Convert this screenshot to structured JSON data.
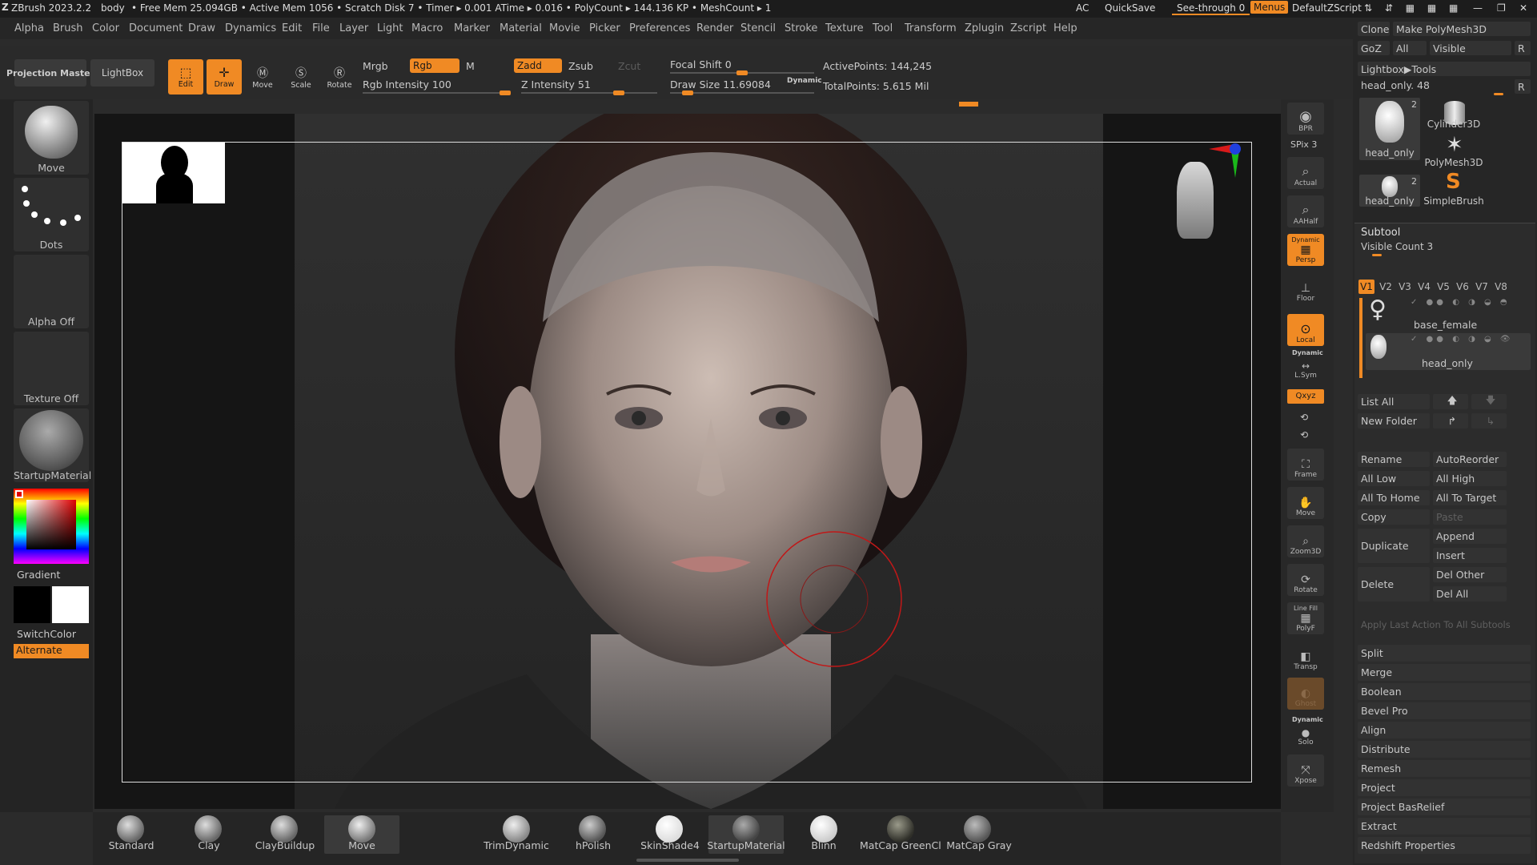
{
  "titlebar": {
    "app": "ZBrush 2023.2.2",
    "doc": "body",
    "status": "• Free Mem 25.094GB • Active Mem 1056 • Scratch Disk 7 • Timer ▸ 0.001 ATime ▸ 0.016 • PolyCount ▸ 144.136 KP • MeshCount ▸ 1",
    "ac": "AC",
    "quicksave": "QuickSave",
    "see_through": "See-through  0",
    "menus": "Menus",
    "zscript": "DefaultZScript"
  },
  "menu": [
    "Alpha",
    "Brush",
    "Color",
    "Document",
    "Draw",
    "Dynamics",
    "Edit",
    "File",
    "Layer",
    "Light",
    "Macro",
    "Marker",
    "Material",
    "Movie",
    "Picker",
    "Preferences",
    "Render",
    "Stencil",
    "Stroke",
    "Texture",
    "Tool",
    "Transform",
    "Zplugin",
    "Zscript",
    "Help"
  ],
  "toolbar": {
    "projection_master": "Projection Master",
    "lightbox": "LightBox",
    "edit": "Edit",
    "draw": "Draw",
    "move": "Move",
    "scale": "Scale",
    "rotate": "Rotate",
    "mrgb": "Mrgb",
    "rgb": "Rgb",
    "m": "M",
    "rgb_intensity": "Rgb Intensity 100",
    "zadd": "Zadd",
    "zsub": "Zsub",
    "zcut": "Zcut",
    "z_intensity": "Z Intensity 51",
    "focal_shift": "Focal Shift 0",
    "draw_size": "Draw Size 11.69084",
    "dynamic": "Dynamic",
    "active_points": "ActivePoints: 144,245",
    "total_points": "TotalPoints: 5.615 Mil"
  },
  "left": {
    "brush": "Move",
    "stroke": "Dots",
    "alpha": "Alpha Off",
    "texture": "Texture Off",
    "material": "StartupMaterial",
    "gradient": "Gradient",
    "switchcolor": "SwitchColor",
    "alternate": "Alternate"
  },
  "right_shelf": {
    "bpr": "BPR",
    "spix": "SPix 3",
    "actual": "Actual",
    "aahalf": "AAHalf",
    "dynamic1": "Dynamic",
    "persp": "Persp",
    "floor": "Floor",
    "local": "Local",
    "dynamic2": "Dynamic",
    "lsym": "L.Sym",
    "xyz": "Qxyz",
    "frame": "Frame",
    "move": "Move",
    "zoom3d": "Zoom3D",
    "rotate": "Rotate",
    "linefill": "Line Fill",
    "polyf": "PolyF",
    "transp": "Transp",
    "ghost": "Ghost",
    "dynamic3": "Dynamic",
    "solo": "Solo",
    "xpose": "Xpose"
  },
  "tool_tray": {
    "clone": "Clone",
    "make_polymesh": "Make PolyMesh3D",
    "goz": "GoZ",
    "all": "All",
    "visible": "Visible",
    "r": "R",
    "lightbox_tools": "Lightbox▶Tools",
    "current_tool": "head_only. 48",
    "thumbs": [
      {
        "label": "head_only",
        "count": "2"
      },
      {
        "label": "Cylinder3D",
        "count": ""
      },
      {
        "label": "PolyMesh3D",
        "count": ""
      },
      {
        "label": "head_only",
        "count": "2"
      },
      {
        "label": "SimpleBrush",
        "count": ""
      }
    ]
  },
  "subtool": {
    "header": "Subtool",
    "visible_count": "Visible Count 3",
    "versions": [
      "V1",
      "V2",
      "V3",
      "V4",
      "V5",
      "V6",
      "V7",
      "V8"
    ],
    "items": [
      {
        "name": "base_female"
      },
      {
        "name": "head_only"
      }
    ],
    "list_all": "List All",
    "new_folder": "New Folder",
    "rename": "Rename",
    "autoreorder": "AutoReorder",
    "all_low": "All Low",
    "all_high": "All High",
    "all_to_home": "All To Home",
    "all_to_target": "All To Target",
    "copy": "Copy",
    "paste": "Paste",
    "duplicate": "Duplicate",
    "append": "Append",
    "insert": "Insert",
    "delete": "Delete",
    "del_other": "Del Other",
    "del_all": "Del All",
    "apply_last": "Apply Last Action To All Subtools",
    "sections": [
      "Split",
      "Merge",
      "Boolean",
      "Bevel Pro",
      "Align",
      "Distribute",
      "Remesh",
      "Project",
      "Project BasRelief",
      "Extract",
      "Redshift Properties"
    ]
  },
  "bottom_brushes": [
    "Standard",
    "Clay",
    "ClayBuildup",
    "Move"
  ],
  "bottom_materials": [
    "TrimDynamic",
    "hPolish",
    "SkinShade4",
    "StartupMaterial",
    "Blinn",
    "MatCap GreenCl",
    "MatCap Gray"
  ],
  "colors": {
    "accent": "#f08a24",
    "red": "#d81a1a",
    "green": "#1ab81a",
    "blue": "#2040e0"
  }
}
